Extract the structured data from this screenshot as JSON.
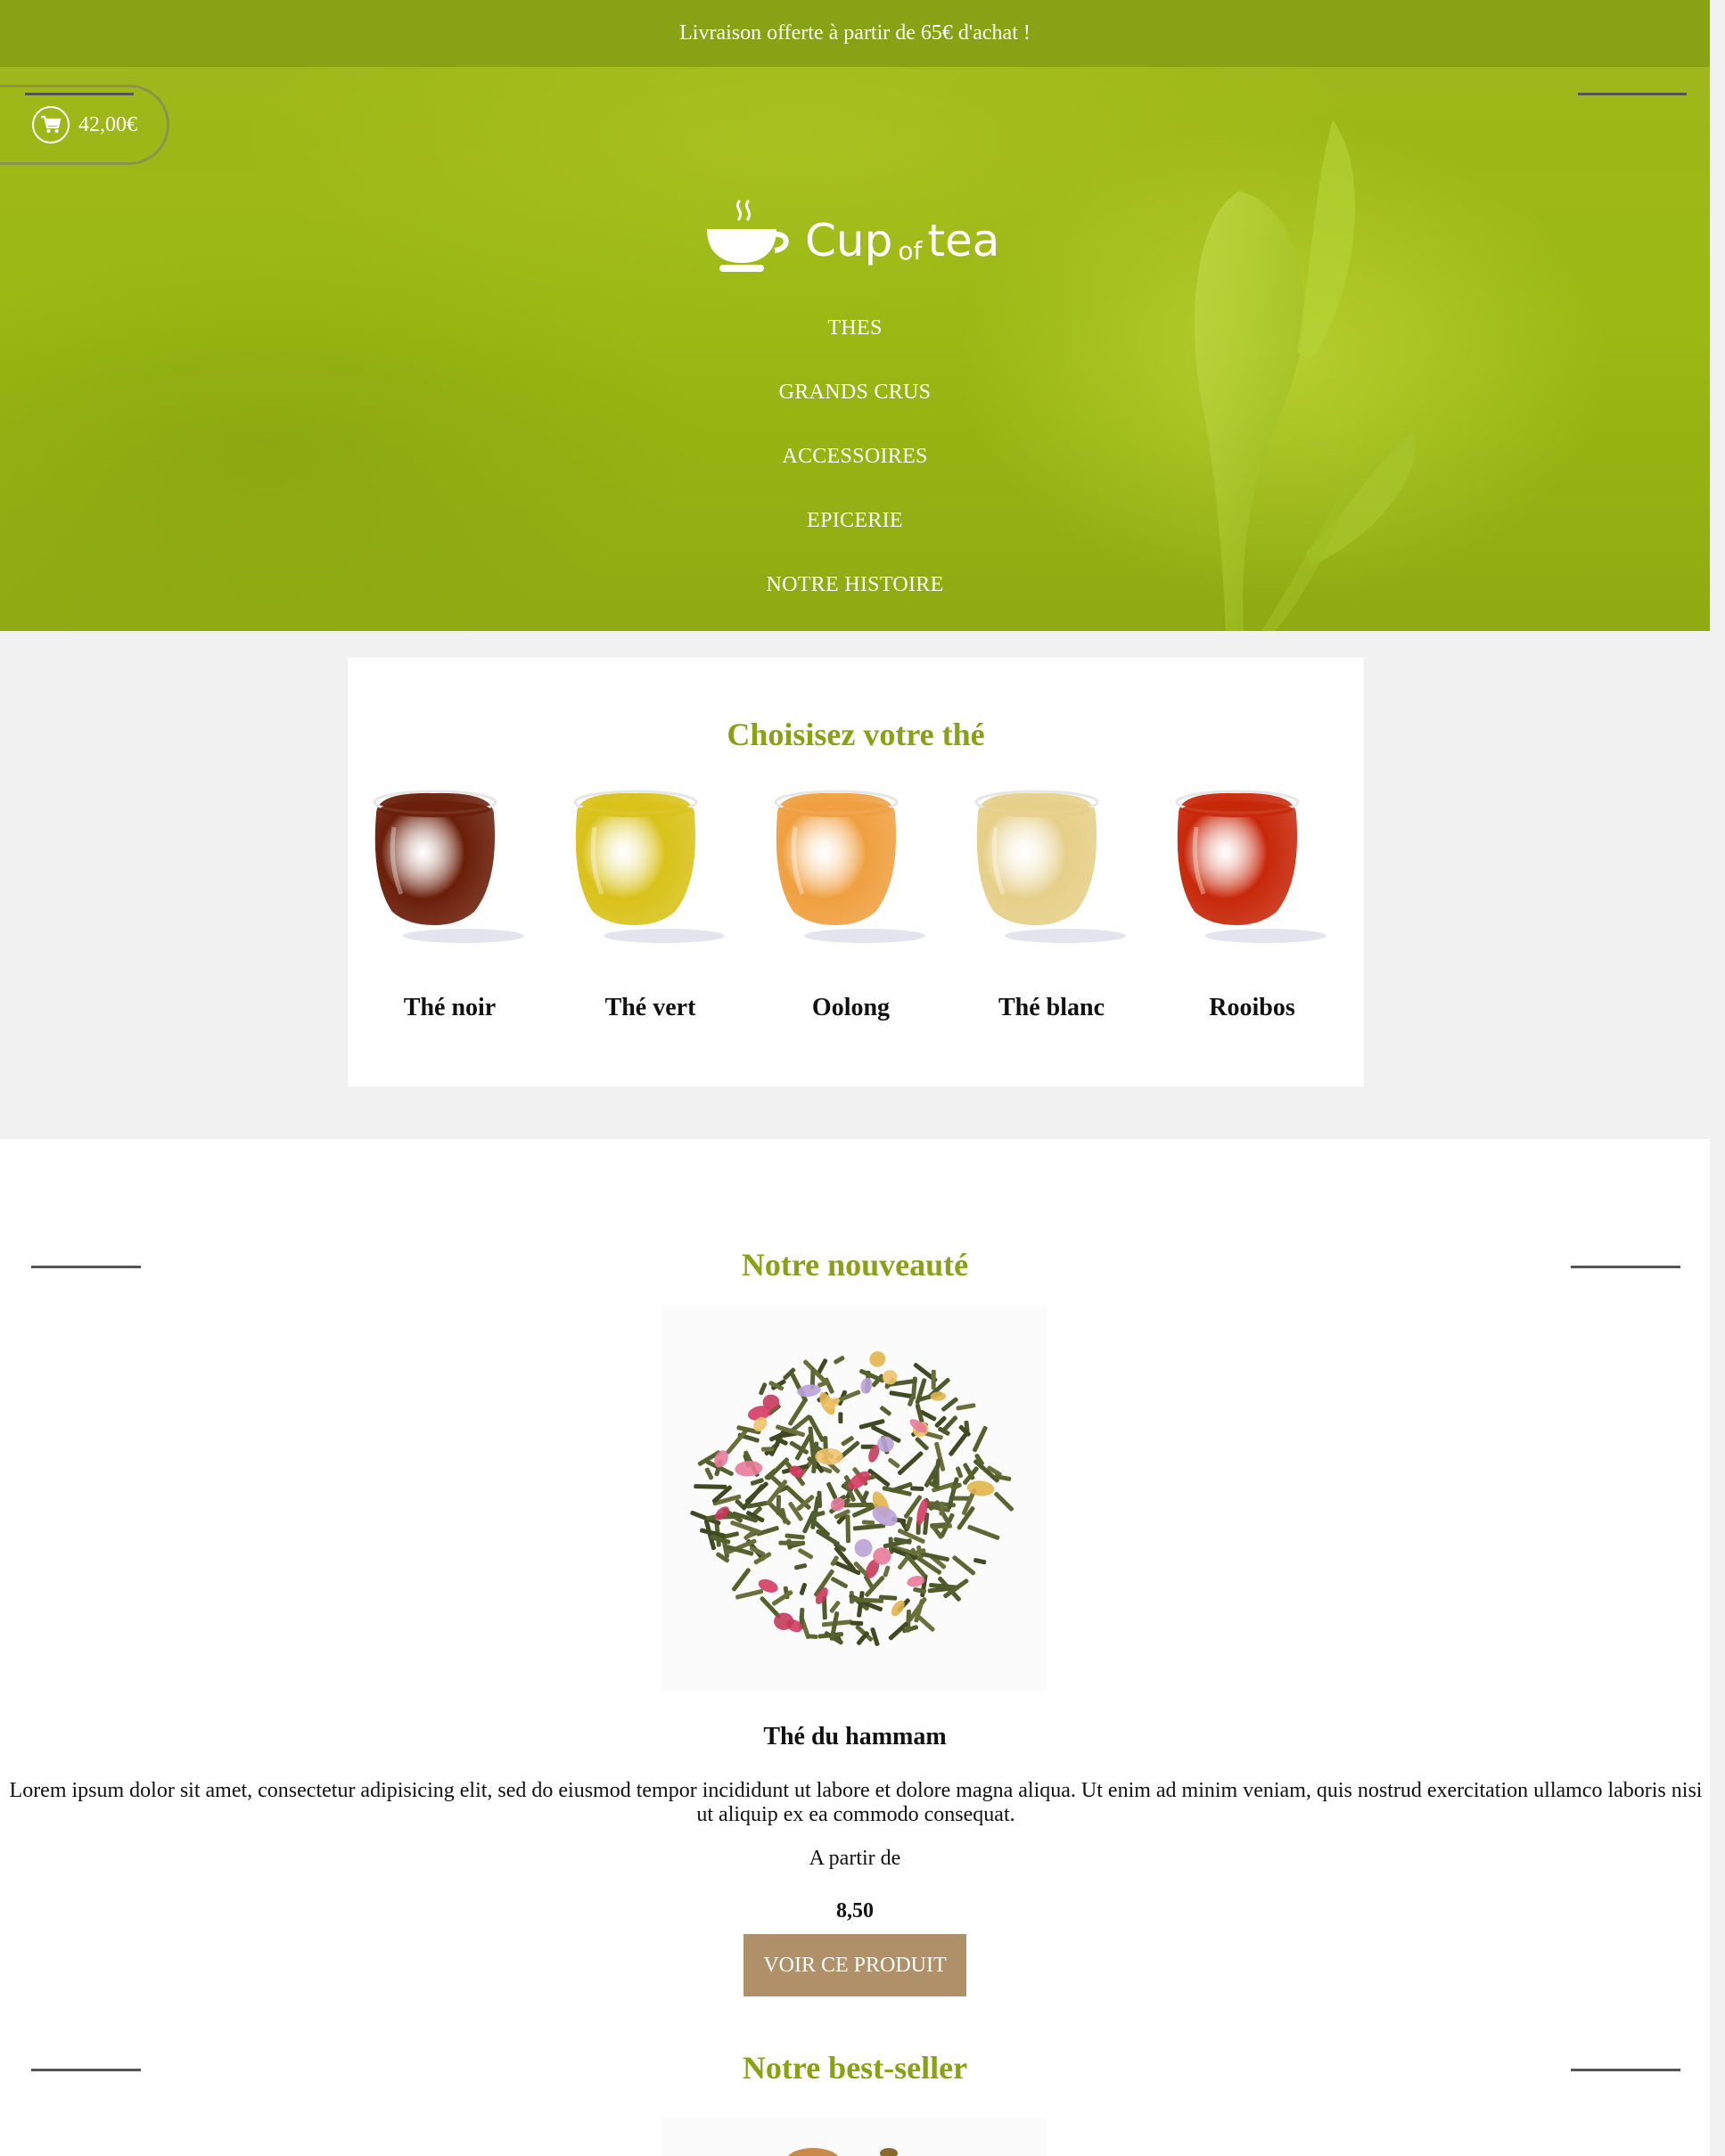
{
  "topbar": {
    "text": "Livraison offerte à partir de 65€ d'achat !"
  },
  "header": {
    "cart_amount": "42,00€",
    "logo": {
      "word1": "Cup",
      "word2": "of",
      "word3": "tea"
    },
    "nav": [
      "THES",
      "GRANDS CRUS",
      "ACCESSOIRES",
      "EPICERIE",
      "NOTRE HISTOIRE"
    ]
  },
  "choose": {
    "title": "Choisisez votre thé",
    "teas": [
      {
        "label": "Thé noir",
        "color": "#6b1f0a"
      },
      {
        "label": "Thé vert",
        "color": "#d9c21a"
      },
      {
        "label": "Oolong",
        "color": "#f0a040"
      },
      {
        "label": "Thé blanc",
        "color": "#e6cf88"
      },
      {
        "label": "Rooibos",
        "color": "#c8280a"
      }
    ]
  },
  "novelty": {
    "title": "Notre nouveauté",
    "name": "Thé du hammam",
    "description": "Lorem ipsum dolor sit amet, consectetur adipisicing elit, sed do eiusmod tempor incididunt ut labore et dolore magna aliqua. Ut enim ad minim veniam, quis nostrud exercitation ullamco laboris nisi ut aliquip ex ea commodo consequat.",
    "price_label": "A partir de",
    "price": "8,50",
    "cta": "VOIR CE PRODUIT"
  },
  "bestseller": {
    "title": "Notre best-seller"
  },
  "colors": {
    "accent": "#89a114",
    "button": "#b09068"
  }
}
